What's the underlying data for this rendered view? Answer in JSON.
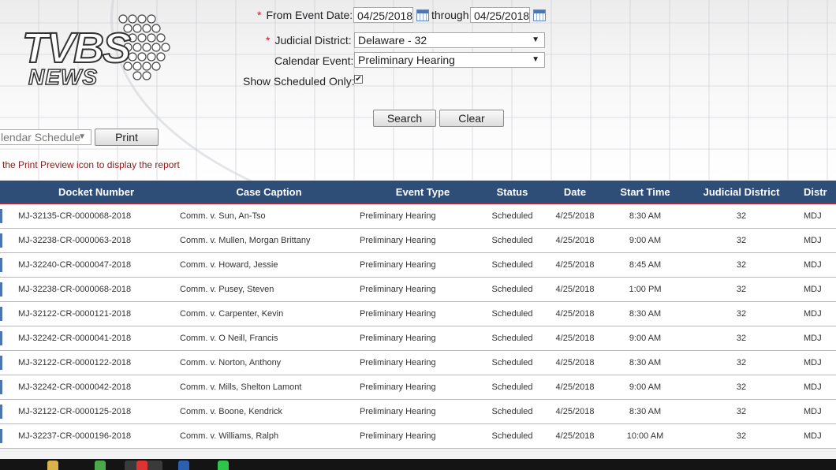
{
  "logo": {
    "brand": "TVBS",
    "sub": "NEWS"
  },
  "form": {
    "from_label": "From Event Date:",
    "from_value": "04/25/2018",
    "through_label": "through",
    "through_value": "04/25/2018",
    "district_label": "Judicial District:",
    "district_value": "Delaware - 32",
    "event_label": "Calendar Event:",
    "event_value": "Preliminary Hearing",
    "scheduled_label": "Show Scheduled Only:",
    "scheduled_checked": true,
    "required_mark": "*",
    "search_label": "Search",
    "clear_label": "Clear"
  },
  "report": {
    "select_value": "lendar Schedule",
    "print_label": "Print",
    "hint": "the Print Preview icon to display the report"
  },
  "table": {
    "headers": [
      "Docket Number",
      "Case Caption",
      "Event Type",
      "Status",
      "Date",
      "Start Time",
      "Judicial District",
      "Distr"
    ],
    "rows": [
      [
        "MJ-32135-CR-0000068-2018",
        "Comm. v. Sun, An-Tso",
        "Preliminary Hearing",
        "Scheduled",
        "4/25/2018",
        "8:30 AM",
        "32",
        "MDJ"
      ],
      [
        "MJ-32238-CR-0000063-2018",
        "Comm. v. Mullen, Morgan Brittany",
        "Preliminary Hearing",
        "Scheduled",
        "4/25/2018",
        "9:00 AM",
        "32",
        "MDJ"
      ],
      [
        "MJ-32240-CR-0000047-2018",
        "Comm. v. Howard, Jessie",
        "Preliminary Hearing",
        "Scheduled",
        "4/25/2018",
        "8:45 AM",
        "32",
        "MDJ"
      ],
      [
        "MJ-32238-CR-0000068-2018",
        "Comm. v. Pusey, Steven",
        "Preliminary Hearing",
        "Scheduled",
        "4/25/2018",
        "1:00 PM",
        "32",
        "MDJ"
      ],
      [
        "MJ-32122-CR-0000121-2018",
        "Comm. v. Carpenter, Kevin",
        "Preliminary Hearing",
        "Scheduled",
        "4/25/2018",
        "8:30 AM",
        "32",
        "MDJ"
      ],
      [
        "MJ-32242-CR-0000041-2018",
        "Comm. v. O Neill, Francis",
        "Preliminary Hearing",
        "Scheduled",
        "4/25/2018",
        "9:00 AM",
        "32",
        "MDJ"
      ],
      [
        "MJ-32122-CR-0000122-2018",
        "Comm. v. Norton, Anthony",
        "Preliminary Hearing",
        "Scheduled",
        "4/25/2018",
        "8:30 AM",
        "32",
        "MDJ"
      ],
      [
        "MJ-32242-CR-0000042-2018",
        "Comm. v. Mills, Shelton Lamont",
        "Preliminary Hearing",
        "Scheduled",
        "4/25/2018",
        "9:00 AM",
        "32",
        "MDJ"
      ],
      [
        "MJ-32122-CR-0000125-2018",
        "Comm. v. Boone, Kendrick",
        "Preliminary Hearing",
        "Scheduled",
        "4/25/2018",
        "8:30 AM",
        "32",
        "MDJ"
      ],
      [
        "MJ-32237-CR-0000196-2018",
        "Comm. v. Williams, Ralph",
        "Preliminary Hearing",
        "Scheduled",
        "4/25/2018",
        "10:00 AM",
        "32",
        "MDJ"
      ]
    ]
  },
  "colors": {
    "header_bg": "#2e4d77",
    "required": "#c0202a",
    "hint_text": "#8b1a1a",
    "row_indicator": "#4d76b0"
  },
  "icons": {
    "calendar": "calendar-icon",
    "dropdown": "chevron-down-icon",
    "checkbox": "checkbox-icon"
  }
}
